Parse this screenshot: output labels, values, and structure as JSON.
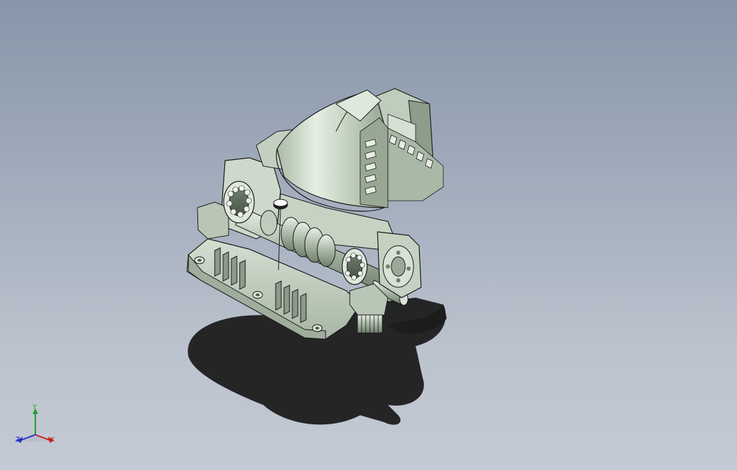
{
  "viewport": {
    "background_top": "#8796aa",
    "background_bottom": "#c4cad3",
    "model": {
      "description_icon": "gearbox-cutaway-3d-model",
      "body_color": "#c9d6c6",
      "shadow_color": "#1a1a1a"
    }
  },
  "triad": {
    "x_label": "X",
    "y_label": "Y",
    "z_label": "Z",
    "x_color": "#c81e1e",
    "y_color": "#1e9e2a",
    "z_color": "#1e2ec8"
  }
}
